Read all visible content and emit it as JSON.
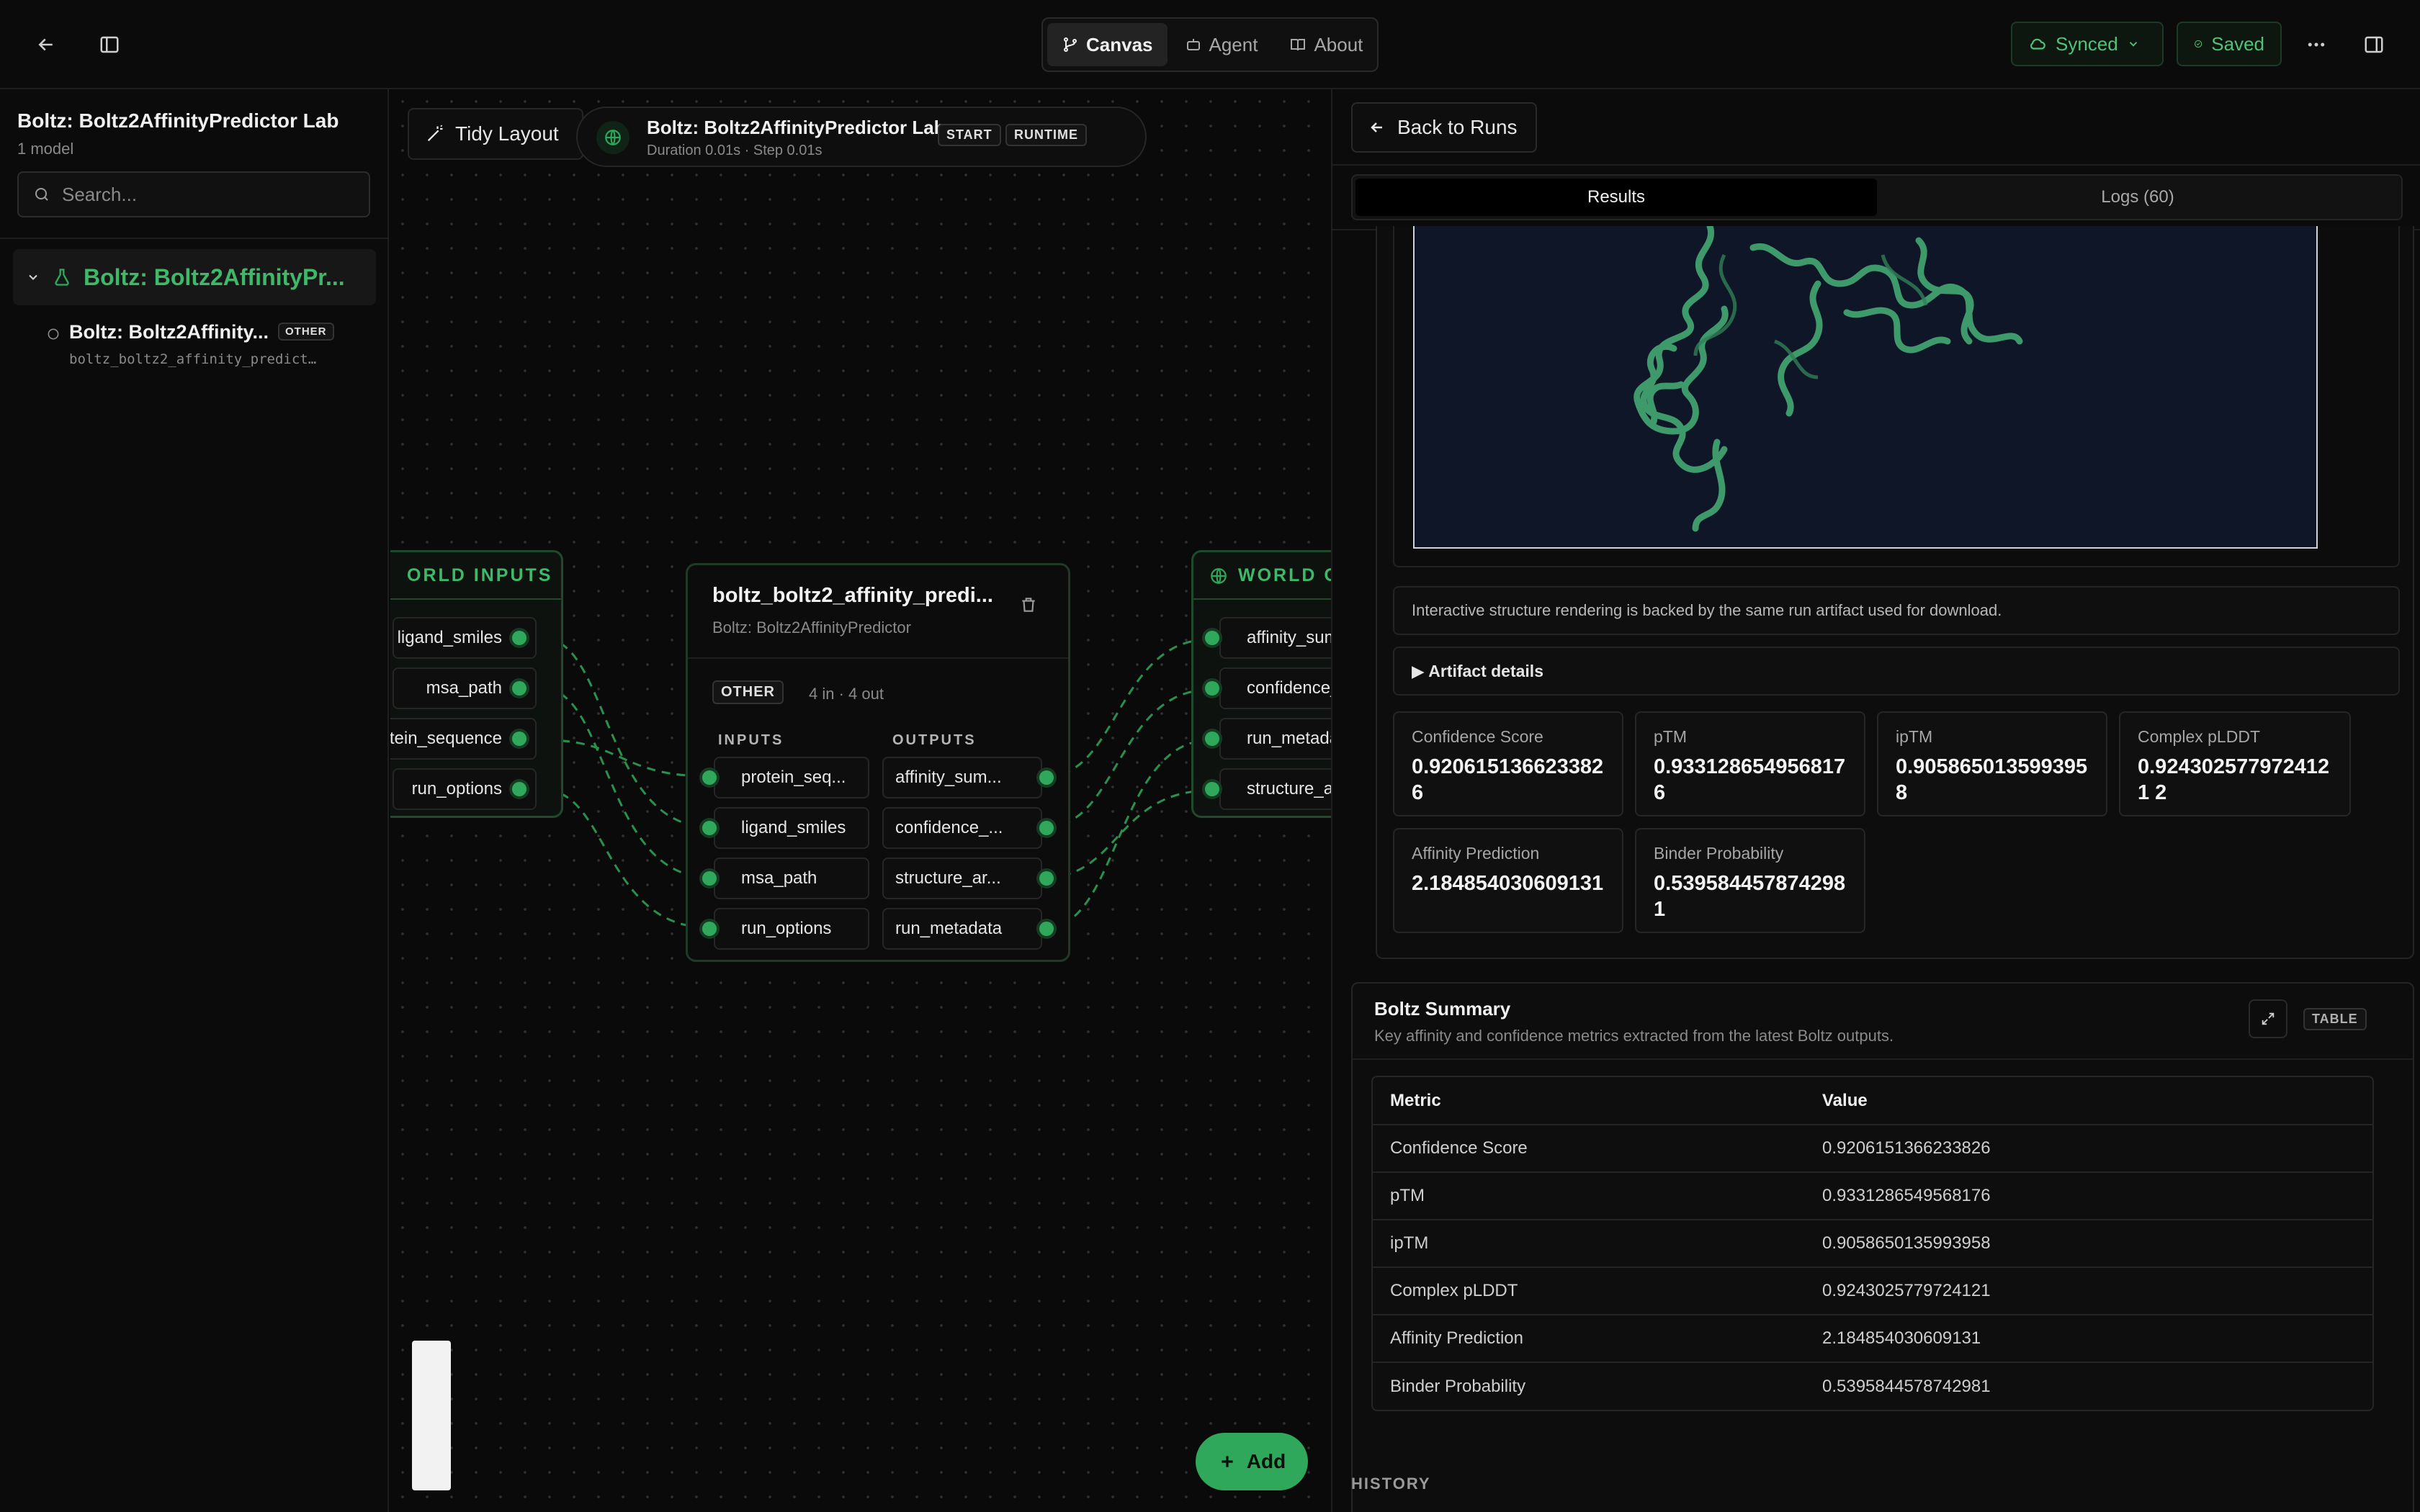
{
  "topbar": {
    "tabs": [
      {
        "label": "Canvas",
        "icon": "branch-icon"
      },
      {
        "label": "Agent",
        "icon": "robot-icon"
      },
      {
        "label": "About",
        "icon": "book-icon"
      }
    ],
    "synced_label": "Synced",
    "saved_label": "Saved"
  },
  "sidebar": {
    "title": "Boltz: Boltz2AffinityPredictor Lab",
    "subtitle": "1 model",
    "search_placeholder": "Search...",
    "group_label": "Boltz: Boltz2AffinityPr...",
    "item": {
      "title": "Boltz: Boltz2Affinity...",
      "badge": "OTHER",
      "subtitle": "boltz_boltz2_affinity_predict…"
    }
  },
  "canvas": {
    "tidy_label": "Tidy Layout",
    "run": {
      "title": "Boltz: Boltz2AffinityPredictor Lab",
      "meta": "Duration 0.01s · Step 0.01s",
      "badge_start": "START",
      "badge_runtime": "RUNTIME"
    },
    "world_inputs": {
      "title": "ORLD INPUTS",
      "ports": [
        "ligand_smiles",
        "msa_path",
        "otein_sequence",
        "run_options"
      ]
    },
    "model_node": {
      "title": "boltz_boltz2_affinity_predi...",
      "subtitle": "Boltz: Boltz2AffinityPredictor",
      "badge": "OTHER",
      "io_summary": "4 in · 4 out",
      "inputs_label": "INPUTS",
      "outputs_label": "OUTPUTS",
      "inputs": [
        "protein_seq...",
        "ligand_smiles",
        "msa_path",
        "run_options"
      ],
      "outputs": [
        "affinity_sum...",
        "confidence_...",
        "structure_ar...",
        "run_metadata"
      ]
    },
    "world_outputs": {
      "title": "WORLD O",
      "ports": [
        "affinity_sum",
        "confidence_",
        "run_metada",
        "structure_a"
      ]
    },
    "add_label": "Add"
  },
  "panel": {
    "back_label": "Back to Runs",
    "tabs": [
      "Results",
      "Logs (60)"
    ],
    "viewer_note": "Interactive structure rendering is backed by the same run artifact used for download.",
    "artifact_details": "▶ Artifact details",
    "metrics": [
      {
        "label": "Confidence Score",
        "value": "0.9206151366233826"
      },
      {
        "label": "pTM",
        "value": "0.9331286549568176"
      },
      {
        "label": "ipTM",
        "value": "0.9058650135993958"
      },
      {
        "label": "Complex pLDDT",
        "value": "0.9243025779724121 2"
      },
      {
        "label": "Affinity Prediction",
        "value": "2.184854030609131"
      },
      {
        "label": "Binder Probability",
        "value": "0.5395844578742981"
      }
    ],
    "summary": {
      "title": "Boltz Summary",
      "subtitle": "Key affinity and confidence metrics extracted from the latest Boltz outputs.",
      "badge": "TABLE",
      "columns": [
        "Metric",
        "Value"
      ],
      "rows": [
        [
          "Confidence Score",
          "0.9206151366233826"
        ],
        [
          "pTM",
          "0.9331286549568176"
        ],
        [
          "ipTM",
          "0.9058650135993958"
        ],
        [
          "Complex pLDDT",
          "0.9243025779724121"
        ],
        [
          "Affinity Prediction",
          "2.184854030609131"
        ],
        [
          "Binder Probability",
          "0.5395844578742981"
        ]
      ]
    },
    "history_label": "HISTORY"
  },
  "colors": {
    "accent": "#2fa85b",
    "accent_text": "#52c27a",
    "protein": "#3e9a6a",
    "viewer_bg": "#0f1628"
  }
}
